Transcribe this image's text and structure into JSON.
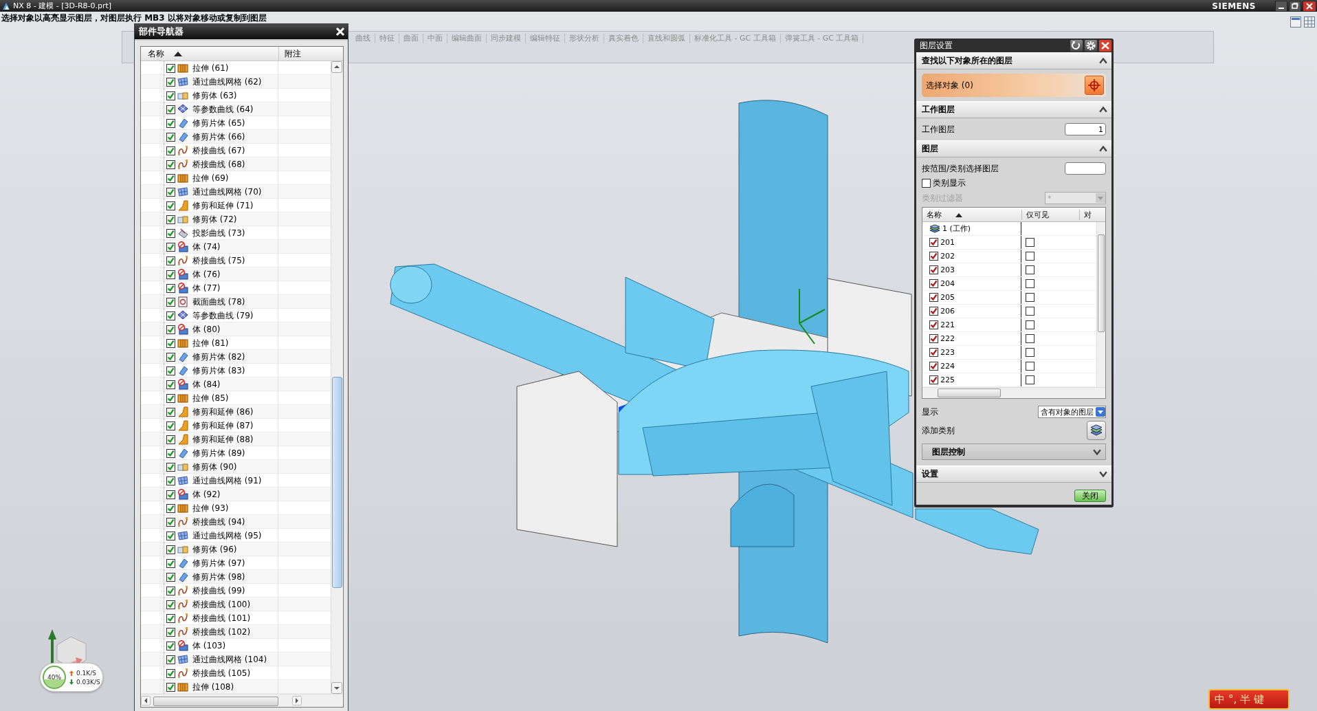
{
  "title_bar": {
    "title": "NX 8 - 建模 - [3D-R8-0.prt]",
    "brand": "SIEMENS"
  },
  "cue_line": "选择对象以高亮显示图层，对图层执行 MB3 以将对象移动或复制到图层",
  "toolbar_tabs": [
    "曲线",
    "特征",
    "曲面",
    "中面",
    "编辑曲面",
    "同步建模",
    "编辑特征",
    "形状分析",
    "真实着色",
    "直线和圆弧",
    "标准化工具 - GC 工具箱",
    "弹簧工具 - GC 工具箱"
  ],
  "part_navigator": {
    "title": "部件导航器",
    "columns": [
      "名称",
      "附注"
    ],
    "items": [
      {
        "label": "拉伸 (61)",
        "kind": "extrude",
        "checked": true
      },
      {
        "label": "通过曲线网格 (62)",
        "kind": "mesh",
        "checked": true
      },
      {
        "label": "修剪体 (63)",
        "kind": "trimbody",
        "checked": true
      },
      {
        "label": "等参数曲线 (64)",
        "kind": "iso",
        "checked": true
      },
      {
        "label": "修剪片体 (65)",
        "kind": "sheet",
        "checked": true
      },
      {
        "label": "修剪片体 (66)",
        "kind": "sheet",
        "checked": true
      },
      {
        "label": "桥接曲线 (67)",
        "kind": "bridge",
        "checked": true
      },
      {
        "label": "桥接曲线 (68)",
        "kind": "bridge",
        "checked": true
      },
      {
        "label": "拉伸 (69)",
        "kind": "extrude",
        "checked": true
      },
      {
        "label": "通过曲线网格 (70)",
        "kind": "mesh",
        "checked": true
      },
      {
        "label": "修剪和延伸 (71)",
        "kind": "trimext",
        "checked": true
      },
      {
        "label": "修剪体 (72)",
        "kind": "trimbody",
        "checked": true
      },
      {
        "label": "投影曲线 (73)",
        "kind": "project",
        "checked": true
      },
      {
        "label": "体 (74)",
        "kind": "body",
        "checked": true
      },
      {
        "label": "桥接曲线 (75)",
        "kind": "bridge",
        "checked": true
      },
      {
        "label": "体 (76)",
        "kind": "body",
        "checked": true
      },
      {
        "label": "体 (77)",
        "kind": "body",
        "checked": true
      },
      {
        "label": "截面曲线 (78)",
        "kind": "section",
        "checked": true
      },
      {
        "label": "等参数曲线 (79)",
        "kind": "iso",
        "checked": true
      },
      {
        "label": "体 (80)",
        "kind": "body",
        "checked": true
      },
      {
        "label": "拉伸 (81)",
        "kind": "extrude",
        "checked": true
      },
      {
        "label": "修剪片体 (82)",
        "kind": "sheet",
        "checked": true
      },
      {
        "label": "修剪片体 (83)",
        "kind": "sheet",
        "checked": true
      },
      {
        "label": "体 (84)",
        "kind": "body",
        "checked": true
      },
      {
        "label": "拉伸 (85)",
        "kind": "extrude",
        "checked": true
      },
      {
        "label": "修剪和延伸 (86)",
        "kind": "trimext",
        "checked": true
      },
      {
        "label": "修剪和延伸 (87)",
        "kind": "trimext",
        "checked": true
      },
      {
        "label": "修剪和延伸 (88)",
        "kind": "trimext",
        "checked": true
      },
      {
        "label": "修剪片体 (89)",
        "kind": "sheet",
        "checked": true
      },
      {
        "label": "修剪体 (90)",
        "kind": "trimbody",
        "checked": true
      },
      {
        "label": "通过曲线网格 (91)",
        "kind": "mesh",
        "checked": true
      },
      {
        "label": "体 (92)",
        "kind": "body",
        "checked": true
      },
      {
        "label": "拉伸 (93)",
        "kind": "extrude",
        "checked": true
      },
      {
        "label": "桥接曲线 (94)",
        "kind": "bridge",
        "checked": true
      },
      {
        "label": "通过曲线网格 (95)",
        "kind": "mesh",
        "checked": true
      },
      {
        "label": "修剪体 (96)",
        "kind": "trimbody",
        "checked": true
      },
      {
        "label": "修剪片体 (97)",
        "kind": "sheet",
        "checked": true
      },
      {
        "label": "修剪片体 (98)",
        "kind": "sheet",
        "checked": true
      },
      {
        "label": "桥接曲线 (99)",
        "kind": "bridge",
        "checked": true
      },
      {
        "label": "桥接曲线 (100)",
        "kind": "bridge",
        "checked": true
      },
      {
        "label": "桥接曲线 (101)",
        "kind": "bridge",
        "checked": true
      },
      {
        "label": "桥接曲线 (102)",
        "kind": "bridge",
        "checked": true
      },
      {
        "label": "体 (103)",
        "kind": "body",
        "checked": true
      },
      {
        "label": "通过曲线网格 (104)",
        "kind": "mesh",
        "checked": true
      },
      {
        "label": "桥接曲线 (105)",
        "kind": "bridge",
        "checked": true
      },
      {
        "label": "拉伸 (108)",
        "kind": "extrude",
        "checked": true
      }
    ]
  },
  "layer_dialog": {
    "title": "图层设置",
    "find_section": {
      "title": "查找以下对象所在的图层",
      "expanded": true,
      "select_label": "选择对象 (0)"
    },
    "work_section": {
      "title": "工作图层",
      "expanded": true,
      "label": "工作图层",
      "value": "1"
    },
    "layers_section": {
      "title": "图层",
      "expanded": true,
      "range_label": "按范围/类别选择图层",
      "category_display": {
        "label": "类别显示",
        "checked": false
      },
      "category_filter": {
        "label": "类别过滤器",
        "value": "*",
        "disabled": true
      },
      "columns": [
        "名称",
        "仅可见",
        "对"
      ],
      "rows": [
        {
          "name": "1 (工作)",
          "kind": "work"
        },
        {
          "name": "201",
          "kind": "layer",
          "checked": true,
          "visible_only": false
        },
        {
          "name": "202",
          "kind": "layer",
          "checked": true,
          "visible_only": false
        },
        {
          "name": "203",
          "kind": "layer",
          "checked": true,
          "visible_only": false
        },
        {
          "name": "204",
          "kind": "layer",
          "checked": true,
          "visible_only": false
        },
        {
          "name": "205",
          "kind": "layer",
          "checked": true,
          "visible_only": false
        },
        {
          "name": "206",
          "kind": "layer",
          "checked": true,
          "visible_only": false
        },
        {
          "name": "221",
          "kind": "layer",
          "checked": true,
          "visible_only": false
        },
        {
          "name": "222",
          "kind": "layer",
          "checked": true,
          "visible_only": false
        },
        {
          "name": "223",
          "kind": "layer",
          "checked": true,
          "visible_only": false
        },
        {
          "name": "224",
          "kind": "layer",
          "checked": true,
          "visible_only": false
        },
        {
          "name": "225",
          "kind": "layer",
          "checked": true,
          "visible_only": false
        }
      ],
      "display": {
        "label": "显示",
        "value": "含有对象的图层"
      },
      "add_category": "添加类别",
      "layer_control": {
        "title": "图层控制",
        "expanded": false
      }
    },
    "settings_section": {
      "title": "设置",
      "expanded": false
    },
    "close_button": "关闭"
  },
  "network_meter": {
    "percent": "40%",
    "upload": "0.1K/S",
    "download": "0.03K/S"
  },
  "ime_bar": {
    "keys": [
      "中",
      "°,",
      "半",
      "键"
    ]
  }
}
